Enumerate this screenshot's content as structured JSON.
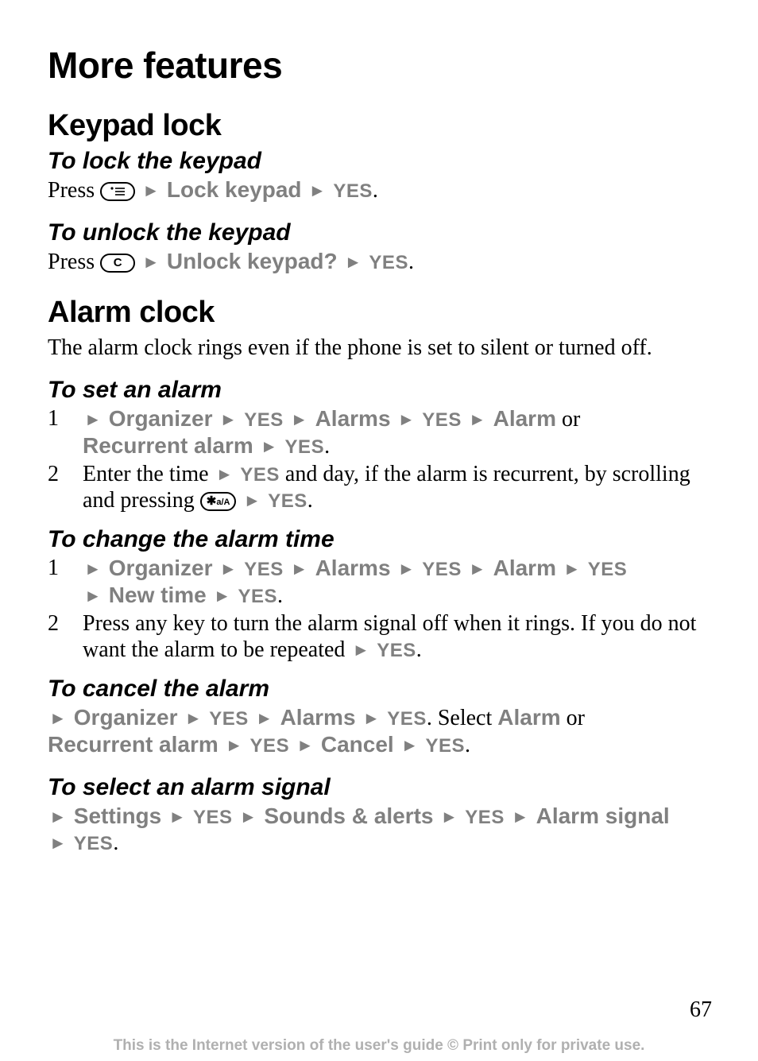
{
  "page": {
    "number": "67",
    "footer": "This is the Internet version of the user's guide © Print only for private use."
  },
  "icons": {
    "menu_key": "menu-key-icon",
    "c_key": "C",
    "star_key": "a/A"
  },
  "labels": {
    "arrow": "►",
    "yes": "YES",
    "lock_keypad": "Lock keypad",
    "unlock_keypad": "Unlock keypad?",
    "organizer": "Organizer",
    "alarms": "Alarms",
    "alarm": "Alarm",
    "recurrent_alarm": "Recurrent alarm",
    "new_time": "New time",
    "cancel": "Cancel",
    "settings": "Settings",
    "sounds_alerts": "Sounds & alerts",
    "alarm_signal": "Alarm signal"
  },
  "headings": {
    "h1": "More features",
    "keypad_lock": "Keypad lock",
    "to_lock": "To lock the keypad",
    "to_unlock": "To unlock the keypad",
    "alarm_clock": "Alarm clock",
    "to_set_alarm": "To set an alarm",
    "to_change_alarm": "To change the alarm time",
    "to_cancel_alarm": "To cancel the alarm",
    "to_select_signal": "To select an alarm signal"
  },
  "text": {
    "press": "Press ",
    "alarm_intro": "The alarm clock rings even if the phone is set to silent or turned off.",
    "or": " or ",
    "enter_time_a": "Enter the time ",
    "enter_time_b": " and day, if the alarm is recurrent, by scrolling and pressing ",
    "any_key": "Press any key to turn the alarm signal off when it rings. If you do not want the alarm to be repeated ",
    "select": ". Select ",
    "period": "."
  },
  "numbers": {
    "one": "1",
    "two": "2"
  }
}
